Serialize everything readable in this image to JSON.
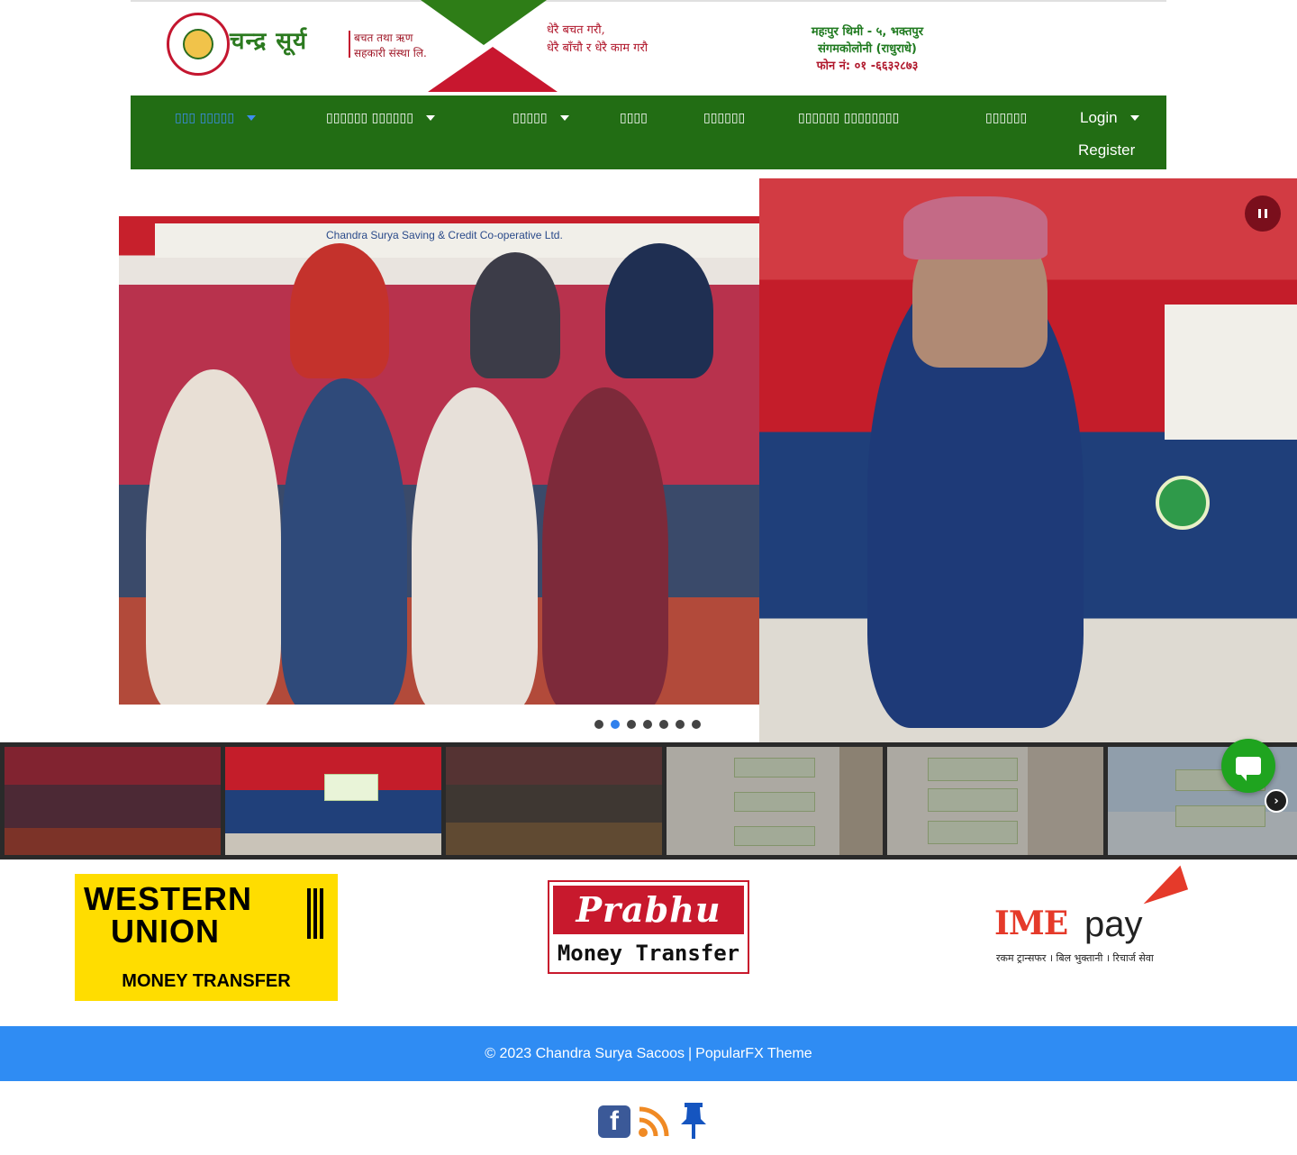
{
  "header": {
    "logo_name": "चन्द्र सूर्य",
    "logo_sub_line1": "बचत तथा ऋण",
    "logo_sub_line2": "सहकारी संस्था लि.",
    "slogan_line1": "धेरै बचत गरौ,",
    "slogan_line2": "धेरै बाँचौ र धेरै काम गरौ",
    "address_line1": "महःपुर थिमी - ५, भक्तपुर",
    "address_line2": "संगमकोलोनी (राधुराधे)",
    "phone_line": "फोन नं: ०१ -६६३२८७३"
  },
  "nav": {
    "items": [
      {
        "label": "▯▯▯ ▯▯▯▯▯",
        "has_caret": true,
        "active": true
      },
      {
        "label": "▯▯▯▯▯▯ ▯▯▯▯▯▯",
        "has_caret": true,
        "active": false
      },
      {
        "label": "▯▯▯▯▯",
        "has_caret": true,
        "active": false
      },
      {
        "label": "▯▯▯▯",
        "has_caret": false,
        "active": false
      },
      {
        "label": "▯▯▯▯▯▯",
        "has_caret": false,
        "active": false
      },
      {
        "label": "▯▯▯▯▯▯ ▯▯▯▯▯▯▯▯",
        "has_caret": false,
        "active": false
      },
      {
        "label": "▯▯▯▯▯▯",
        "has_caret": false,
        "active": false
      },
      {
        "label": "Login",
        "has_caret": true,
        "active": false
      },
      {
        "label": "Register",
        "has_caret": false,
        "active": false
      }
    ],
    "active_color": "#3d8ef0",
    "background": "#226d14"
  },
  "slider": {
    "banner_text": "Chandra Surya Saving & Credit Co-operative Ltd.",
    "dot_count": 7,
    "active_dot": 2,
    "pause_icon": "pause-icon"
  },
  "thumbnails": {
    "count": 6,
    "selected": 2,
    "next_icon": "chevron-right-icon"
  },
  "partners": {
    "western_union": {
      "line1": "WESTERN",
      "line2": "UNION",
      "bottom": "MONEY TRANSFER"
    },
    "prabhu": {
      "top": "Prabhu",
      "bottom": "Money Transfer"
    },
    "imepay": {
      "ime": "IME",
      "pay": "pay",
      "tagline": "रकम ट्रान्सफर । बिल भुक्तानी । रिचार्ज सेवा"
    }
  },
  "footer": {
    "copyright": "© 2023 Chandra Surya Sacoos",
    "separator": "|",
    "theme_link": "PopularFX Theme",
    "color": "#2f8cf3"
  },
  "social": {
    "icons": [
      "facebook-icon",
      "rss-icon",
      "pin-icon"
    ]
  },
  "chat": {
    "icon": "chat-icon",
    "color": "#1fa41f"
  }
}
